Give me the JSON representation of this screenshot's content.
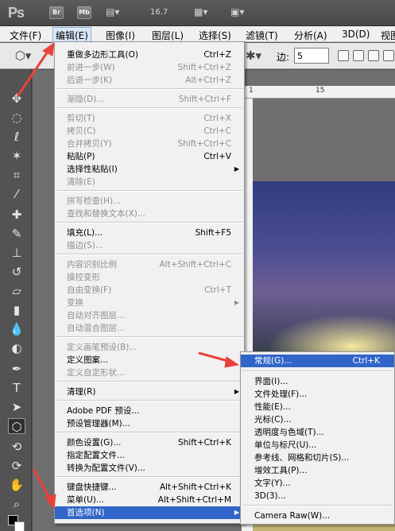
{
  "app": {
    "logo": "Ps",
    "buttons": [
      "Br",
      "Mb"
    ],
    "zoom": "16.7",
    "icons": [
      "film-strip-icon",
      "layout-arrange-icon",
      "screen-mode-icon"
    ]
  },
  "menubar": {
    "items": [
      "文件(F)",
      "编辑(E)",
      "图像(I)",
      "图层(L)",
      "选择(S)",
      "滤镜(T)",
      "分析(A)",
      "3D(D)",
      "视图"
    ],
    "active_index": 1
  },
  "options": {
    "sides_label": "边:",
    "sides_value": "5"
  },
  "ruler": {
    "ticks": [
      "1",
      "15"
    ]
  },
  "edit_menu": {
    "items": [
      {
        "label": "重做多边形工具(O)",
        "shortcut": "Ctrl+Z",
        "disabled": false
      },
      {
        "label": "前进一步(W)",
        "shortcut": "Shift+Ctrl+Z",
        "disabled": true
      },
      {
        "label": "后退一步(K)",
        "shortcut": "Alt+Ctrl+Z",
        "disabled": true
      },
      {
        "label": "渐隐(D)...",
        "shortcut": "Shift+Ctrl+F",
        "disabled": true
      },
      {
        "label": "剪切(T)",
        "shortcut": "Ctrl+X",
        "disabled": true
      },
      {
        "label": "拷贝(C)",
        "shortcut": "Ctrl+C",
        "disabled": true
      },
      {
        "label": "合并拷贝(Y)",
        "shortcut": "Shift+Ctrl+C",
        "disabled": true
      },
      {
        "label": "粘贴(P)",
        "shortcut": "Ctrl+V",
        "disabled": false
      },
      {
        "label": "选择性粘贴(I)",
        "shortcut": "",
        "disabled": false,
        "submenu": true
      },
      {
        "label": "清除(E)",
        "shortcut": "",
        "disabled": true
      },
      {
        "label": "拼写检查(H)...",
        "shortcut": "",
        "disabled": true
      },
      {
        "label": "查找和替换文本(X)...",
        "shortcut": "",
        "disabled": true
      },
      {
        "label": "填充(L)...",
        "shortcut": "Shift+F5",
        "disabled": false
      },
      {
        "label": "描边(S)...",
        "shortcut": "",
        "disabled": true
      },
      {
        "label": "内容识别比例",
        "shortcut": "Alt+Shift+Ctrl+C",
        "disabled": true
      },
      {
        "label": "操控变形",
        "shortcut": "",
        "disabled": true
      },
      {
        "label": "自由变换(F)",
        "shortcut": "Ctrl+T",
        "disabled": true
      },
      {
        "label": "变换",
        "shortcut": "",
        "disabled": true,
        "submenu": true
      },
      {
        "label": "自动对齐图层...",
        "shortcut": "",
        "disabled": true
      },
      {
        "label": "自动混合图层...",
        "shortcut": "",
        "disabled": true
      },
      {
        "label": "定义画笔预设(B)...",
        "shortcut": "",
        "disabled": true
      },
      {
        "label": "定义图案...",
        "shortcut": "",
        "disabled": false
      },
      {
        "label": "定义自定形状...",
        "shortcut": "",
        "disabled": true
      },
      {
        "label": "清理(R)",
        "shortcut": "",
        "disabled": false,
        "submenu": true
      },
      {
        "label": "Adobe PDF 预设...",
        "shortcut": "",
        "disabled": false
      },
      {
        "label": "预设管理器(M)...",
        "shortcut": "",
        "disabled": false
      },
      {
        "label": "颜色设置(G)...",
        "shortcut": "Shift+Ctrl+K",
        "disabled": false
      },
      {
        "label": "指定配置文件...",
        "shortcut": "",
        "disabled": false
      },
      {
        "label": "转换为配置文件(V)...",
        "shortcut": "",
        "disabled": false
      },
      {
        "label": "键盘快捷键...",
        "shortcut": "Alt+Shift+Ctrl+K",
        "disabled": false
      },
      {
        "label": "菜单(U)...",
        "shortcut": "Alt+Shift+Ctrl+M",
        "disabled": false
      },
      {
        "label": "首选项(N)",
        "shortcut": "",
        "disabled": false,
        "submenu": true,
        "highlight": true
      }
    ]
  },
  "prefs_submenu": {
    "items": [
      {
        "label": "常规(G)...",
        "shortcut": "Ctrl+K",
        "highlight": true
      },
      {
        "label": "界面(I)...",
        "shortcut": ""
      },
      {
        "label": "文件处理(F)...",
        "shortcut": ""
      },
      {
        "label": "性能(E)...",
        "shortcut": ""
      },
      {
        "label": "光标(C)...",
        "shortcut": ""
      },
      {
        "label": "透明度与色域(T)...",
        "shortcut": ""
      },
      {
        "label": "单位与标尺(U)...",
        "shortcut": ""
      },
      {
        "label": "参考线、网格和切片(S)...",
        "shortcut": ""
      },
      {
        "label": "增效工具(P)...",
        "shortcut": ""
      },
      {
        "label": "文字(Y)...",
        "shortcut": ""
      },
      {
        "label": "3D(3)...",
        "shortcut": ""
      },
      {
        "label": "Camera Raw(W)...",
        "shortcut": ""
      }
    ]
  },
  "colors": {
    "highlight": "#3166c8",
    "annotation_arrow": "#e8423a"
  }
}
